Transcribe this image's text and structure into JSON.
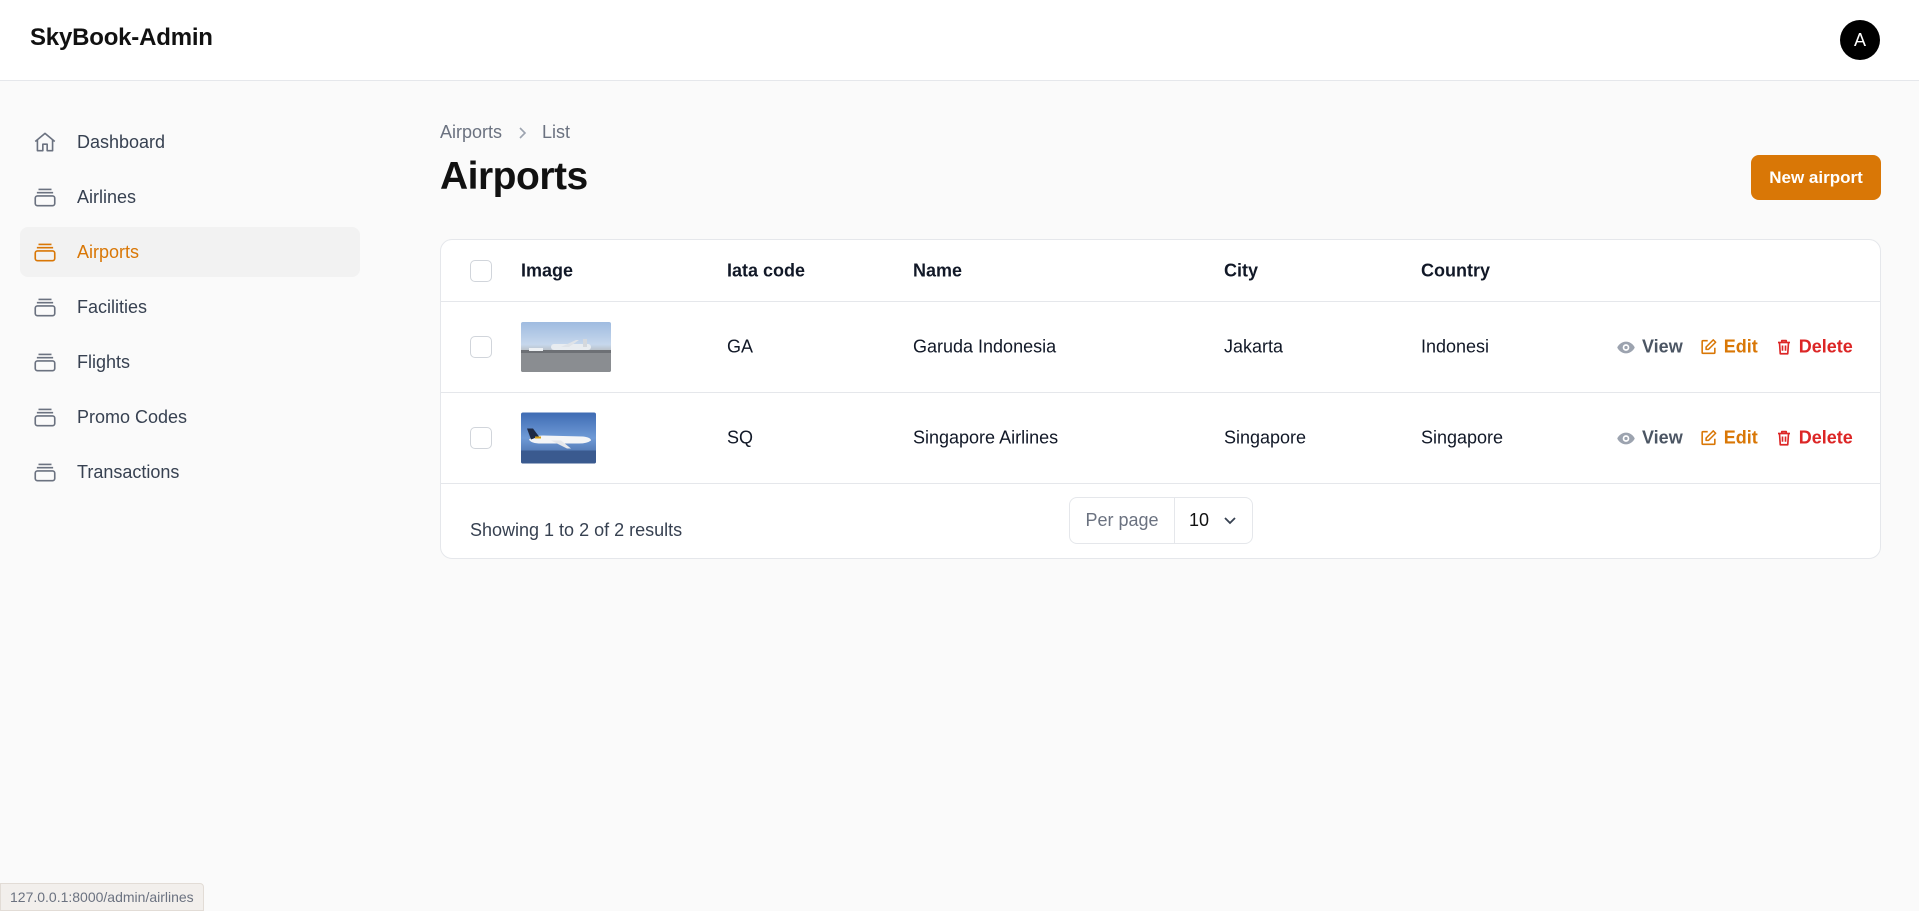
{
  "app": {
    "brand": "SkyBook-Admin",
    "avatar_initial": "A"
  },
  "sidebar": {
    "items": [
      {
        "label": "Dashboard",
        "icon": "home-icon",
        "active": false
      },
      {
        "label": "Airlines",
        "icon": "stack-icon",
        "active": false
      },
      {
        "label": "Airports",
        "icon": "stack-icon",
        "active": true
      },
      {
        "label": "Facilities",
        "icon": "stack-icon",
        "active": false
      },
      {
        "label": "Flights",
        "icon": "stack-icon",
        "active": false
      },
      {
        "label": "Promo Codes",
        "icon": "stack-icon",
        "active": false
      },
      {
        "label": "Transactions",
        "icon": "stack-icon",
        "active": false
      }
    ]
  },
  "breadcrumb": {
    "parent": "Airports",
    "current": "List"
  },
  "page": {
    "title": "Airports",
    "new_button": "New airport"
  },
  "table": {
    "columns": {
      "image": "Image",
      "iata": "Iata code",
      "name": "Name",
      "city": "City",
      "country": "Country"
    },
    "rows": [
      {
        "iata": "GA",
        "name": "Garuda Indonesia",
        "city": "Jakarta",
        "country": "Indonesi"
      },
      {
        "iata": "SQ",
        "name": "Singapore Airlines",
        "city": "Singapore",
        "country": "Singapore"
      }
    ],
    "actions": {
      "view": "View",
      "edit": "Edit",
      "delete": "Delete"
    }
  },
  "pagination": {
    "summary": "Showing 1 to 2 of 2 results",
    "per_page_label": "Per page",
    "per_page_value": "10"
  },
  "status_url": "127.0.0.1:8000/admin/airlines",
  "colors": {
    "accent": "#d97706",
    "danger": "#dc2626",
    "muted": "#6b7280"
  }
}
